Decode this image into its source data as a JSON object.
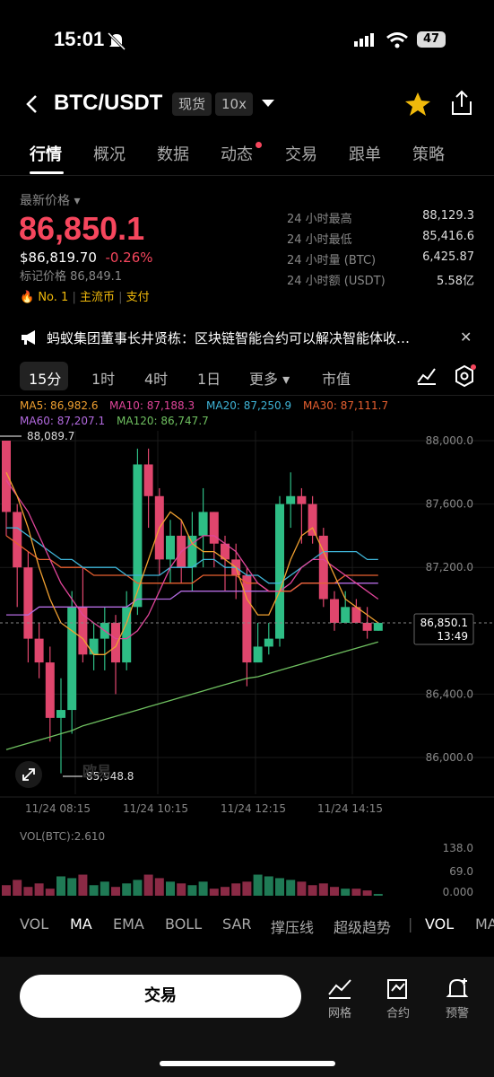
{
  "status_bar": {
    "time": "15:01",
    "battery": "47"
  },
  "header": {
    "pair": "BTC/USDT",
    "market_tag": "现货",
    "leverage_tag": "10x"
  },
  "tabs": [
    {
      "label": "行情",
      "active": true
    },
    {
      "label": "概况"
    },
    {
      "label": "数据"
    },
    {
      "label": "动态",
      "dot": true
    },
    {
      "label": "交易"
    },
    {
      "label": "跟单"
    },
    {
      "label": "策略"
    }
  ],
  "price": {
    "label": "最新价格",
    "last": "86,850.1",
    "usd": "$86,819.70",
    "change": "-0.26%",
    "mark": "标记价格 86,849.1",
    "rank": "No. 1",
    "tag1": "主流币",
    "tag2": "支付"
  },
  "stats": [
    {
      "k": "24 小时最高",
      "v": "88,129.3"
    },
    {
      "k": "24 小时最低",
      "v": "85,416.6"
    },
    {
      "k": "24 小时量 (BTC)",
      "v": "6,425.87"
    },
    {
      "k": "24 小时额 (USDT)",
      "v": "5.58亿"
    }
  ],
  "news": {
    "text": "蚂蚁集团董事长井贤栋：区块链智能合约可以解决智能体收…"
  },
  "periods": {
    "p15": "15分",
    "p1h": "1时",
    "p4h": "4时",
    "p1d": "1日",
    "more": "更多",
    "market": "市值"
  },
  "ma": {
    "ma5": "MA5: 86,982.6",
    "ma10": "MA10: 87,188.3",
    "ma20": "MA20: 87,250.9",
    "ma30": "MA30: 87,111.7",
    "ma60": "MA60: 87,207.1",
    "ma120": "MA120: 86,747.7"
  },
  "chart_data": {
    "type": "candlestick",
    "y_ticks": [
      "88,000.0",
      "87,600.0",
      "87,200.0",
      "86,400.0",
      "86,000.0"
    ],
    "x_ticks": [
      "11/24 08:15",
      "11/24 10:15",
      "11/24 12:15",
      "11/24 14:15"
    ],
    "high_label": "88,089.7",
    "low_label": "85,948.8",
    "current_price": "86,850.1",
    "countdown": "13:49",
    "watermark": "欧易",
    "candles": [
      [
        88000,
        87550,
        88000,
        87400
      ],
      [
        87550,
        87200,
        87600,
        86950
      ],
      [
        87200,
        86750,
        87300,
        86600
      ],
      [
        86750,
        86600,
        86850,
        86500
      ],
      [
        86600,
        86250,
        86700,
        86100
      ],
      [
        86250,
        86300,
        86500,
        85900
      ],
      [
        86300,
        86950,
        87050,
        86150
      ],
      [
        86950,
        86650,
        87200,
        86600
      ],
      [
        86650,
        86750,
        86850,
        86550
      ],
      [
        86750,
        86850,
        86950,
        86550
      ],
      [
        86850,
        86600,
        86900,
        86400
      ],
      [
        86600,
        86950,
        87050,
        86550
      ],
      [
        86950,
        87850,
        87950,
        86900
      ],
      [
        87850,
        87650,
        87950,
        87450
      ],
      [
        87650,
        87250,
        87700,
        87150
      ],
      [
        87250,
        87400,
        87500,
        87100
      ],
      [
        87400,
        87200,
        87500,
        87100
      ],
      [
        87200,
        87400,
        87550,
        87050
      ],
      [
        87400,
        87550,
        87700,
        87200
      ],
      [
        87550,
        87350,
        87550,
        87200
      ],
      [
        87350,
        87250,
        87400,
        87050
      ],
      [
        87250,
        87150,
        87350,
        87000
      ],
      [
        87150,
        86600,
        87200,
        86450
      ],
      [
        86600,
        86700,
        86850,
        86600
      ],
      [
        86700,
        86750,
        86850,
        86650
      ],
      [
        86750,
        87600,
        87650,
        86700
      ],
      [
        87600,
        87650,
        87800,
        87450
      ],
      [
        87650,
        87600,
        87700,
        87350
      ],
      [
        87600,
        87400,
        87650,
        87350
      ],
      [
        87400,
        87000,
        87450,
        86950
      ],
      [
        87000,
        86850,
        87050,
        86800
      ],
      [
        86850,
        86950,
        87050,
        86850
      ],
      [
        86950,
        86850,
        87000,
        86850
      ],
      [
        86850,
        86800,
        86950,
        86750
      ],
      [
        86800,
        86850,
        86850,
        86800
      ]
    ],
    "ma5": [
      87800,
      87650,
      87450,
      87200,
      87000,
      86850,
      86800,
      86750,
      86650,
      86650,
      86700,
      86850,
      87050,
      87250,
      87450,
      87550,
      87500,
      87350,
      87300,
      87300,
      87250,
      87200,
      87000,
      86900,
      86900,
      87050,
      87250,
      87400,
      87450,
      87300,
      87150,
      87000,
      86950,
      86900,
      86850
    ],
    "ma10": [
      87750,
      87650,
      87550,
      87400,
      87250,
      87100,
      87000,
      86900,
      86850,
      86800,
      86750,
      86750,
      86800,
      86900,
      87050,
      87200,
      87300,
      87350,
      87400,
      87400,
      87350,
      87300,
      87200,
      87100,
      87050,
      87050,
      87100,
      87200,
      87250,
      87250,
      87200,
      87150,
      87100,
      87050,
      87000
    ],
    "ma20": [
      87450,
      87450,
      87400,
      87350,
      87300,
      87250,
      87250,
      87200,
      87200,
      87200,
      87200,
      87150,
      87150,
      87150,
      87150,
      87200,
      87200,
      87200,
      87250,
      87250,
      87200,
      87200,
      87150,
      87150,
      87100,
      87100,
      87150,
      87200,
      87250,
      87300,
      87300,
      87300,
      87300,
      87250,
      87250
    ],
    "ma30": [
      87400,
      87350,
      87300,
      87250,
      87250,
      87200,
      87200,
      87200,
      87150,
      87150,
      87150,
      87150,
      87100,
      87100,
      87100,
      87100,
      87100,
      87100,
      87150,
      87150,
      87150,
      87150,
      87100,
      87100,
      87050,
      87050,
      87050,
      87100,
      87100,
      87100,
      87100,
      87150,
      87150,
      87150,
      87150
    ],
    "ma60": [
      86900,
      86900,
      86900,
      86950,
      86950,
      86950,
      86950,
      86950,
      86950,
      86950,
      86950,
      86950,
      87000,
      87000,
      87000,
      87000,
      87050,
      87050,
      87050,
      87050,
      87050,
      87050,
      87050,
      87050,
      87050,
      87050,
      87050,
      87100,
      87100,
      87100,
      87100,
      87100,
      87100,
      87100,
      87100
    ],
    "ma120": [
      86050,
      86070,
      86090,
      86110,
      86130,
      86150,
      86170,
      86200,
      86220,
      86240,
      86260,
      86280,
      86300,
      86320,
      86340,
      86360,
      86380,
      86400,
      86420,
      86440,
      86460,
      86480,
      86500,
      86510,
      86530,
      86550,
      86570,
      86590,
      86610,
      86630,
      86650,
      86670,
      86690,
      86710,
      86730
    ],
    "volume": [
      30,
      45,
      25,
      35,
      20,
      55,
      50,
      60,
      30,
      40,
      25,
      35,
      45,
      60,
      50,
      40,
      35,
      30,
      40,
      20,
      25,
      35,
      40,
      60,
      55,
      50,
      45,
      40,
      30,
      35,
      25,
      20,
      20,
      15,
      5
    ],
    "vol_ticks": [
      "138.0",
      "69.0",
      "0.000"
    ],
    "vol_label": "VOL(BTC):2.610"
  },
  "indicators": [
    "VOL",
    "MA",
    "EMA",
    "BOLL",
    "SAR",
    "撑压线",
    "超级趋势",
    "VOL",
    "MA"
  ],
  "bottom": {
    "trade": "交易",
    "grid": "网格",
    "contract": "合约",
    "alert": "预警"
  }
}
